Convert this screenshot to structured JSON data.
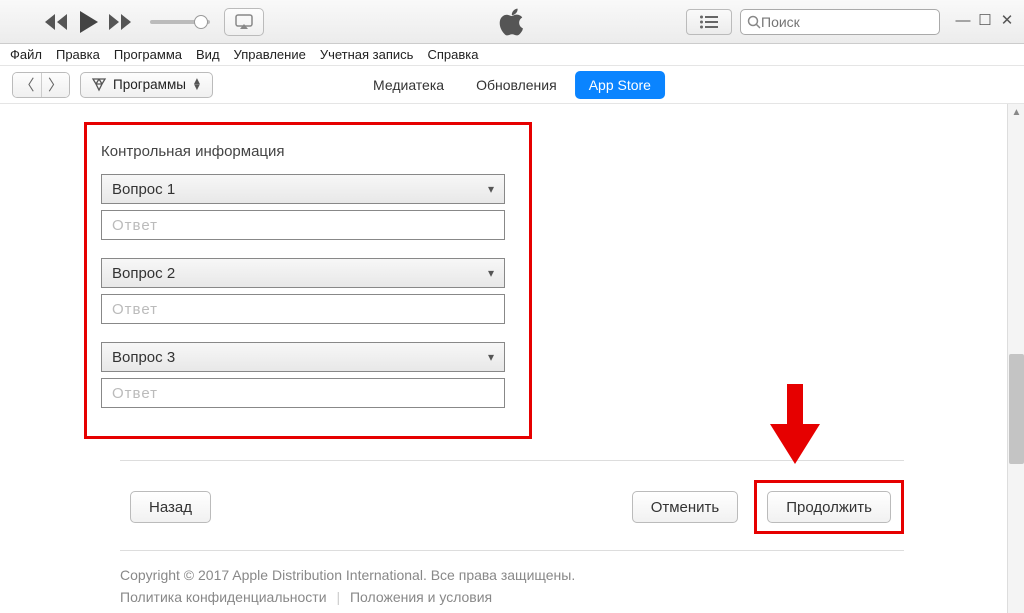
{
  "toolbar": {
    "search_placeholder": "Поиск"
  },
  "menubar": {
    "items": [
      "Файл",
      "Правка",
      "Программа",
      "Вид",
      "Управление",
      "Учетная запись",
      "Справка"
    ]
  },
  "subbar": {
    "category_label": "Программы",
    "tabs": [
      "Медиатека",
      "Обновления",
      "App Store"
    ],
    "active_tab_index": 2
  },
  "form": {
    "section_title": "Контрольная информация",
    "questions": [
      {
        "select_label": "Вопрос 1",
        "answer_placeholder": "Ответ"
      },
      {
        "select_label": "Вопрос 2",
        "answer_placeholder": "Ответ"
      },
      {
        "select_label": "Вопрос 3",
        "answer_placeholder": "Ответ"
      }
    ]
  },
  "buttons": {
    "back": "Назад",
    "cancel": "Отменить",
    "continue": "Продолжить"
  },
  "footer": {
    "copyright": "Copyright © 2017 Apple Distribution International. Все права защищены.",
    "privacy": "Политика конфиденциальности",
    "terms": "Положения и условия"
  }
}
